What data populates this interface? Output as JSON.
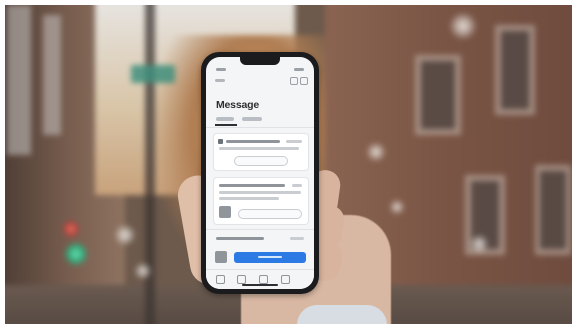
{
  "screen": {
    "title": "Message",
    "accent_color": "#2c7be5"
  }
}
